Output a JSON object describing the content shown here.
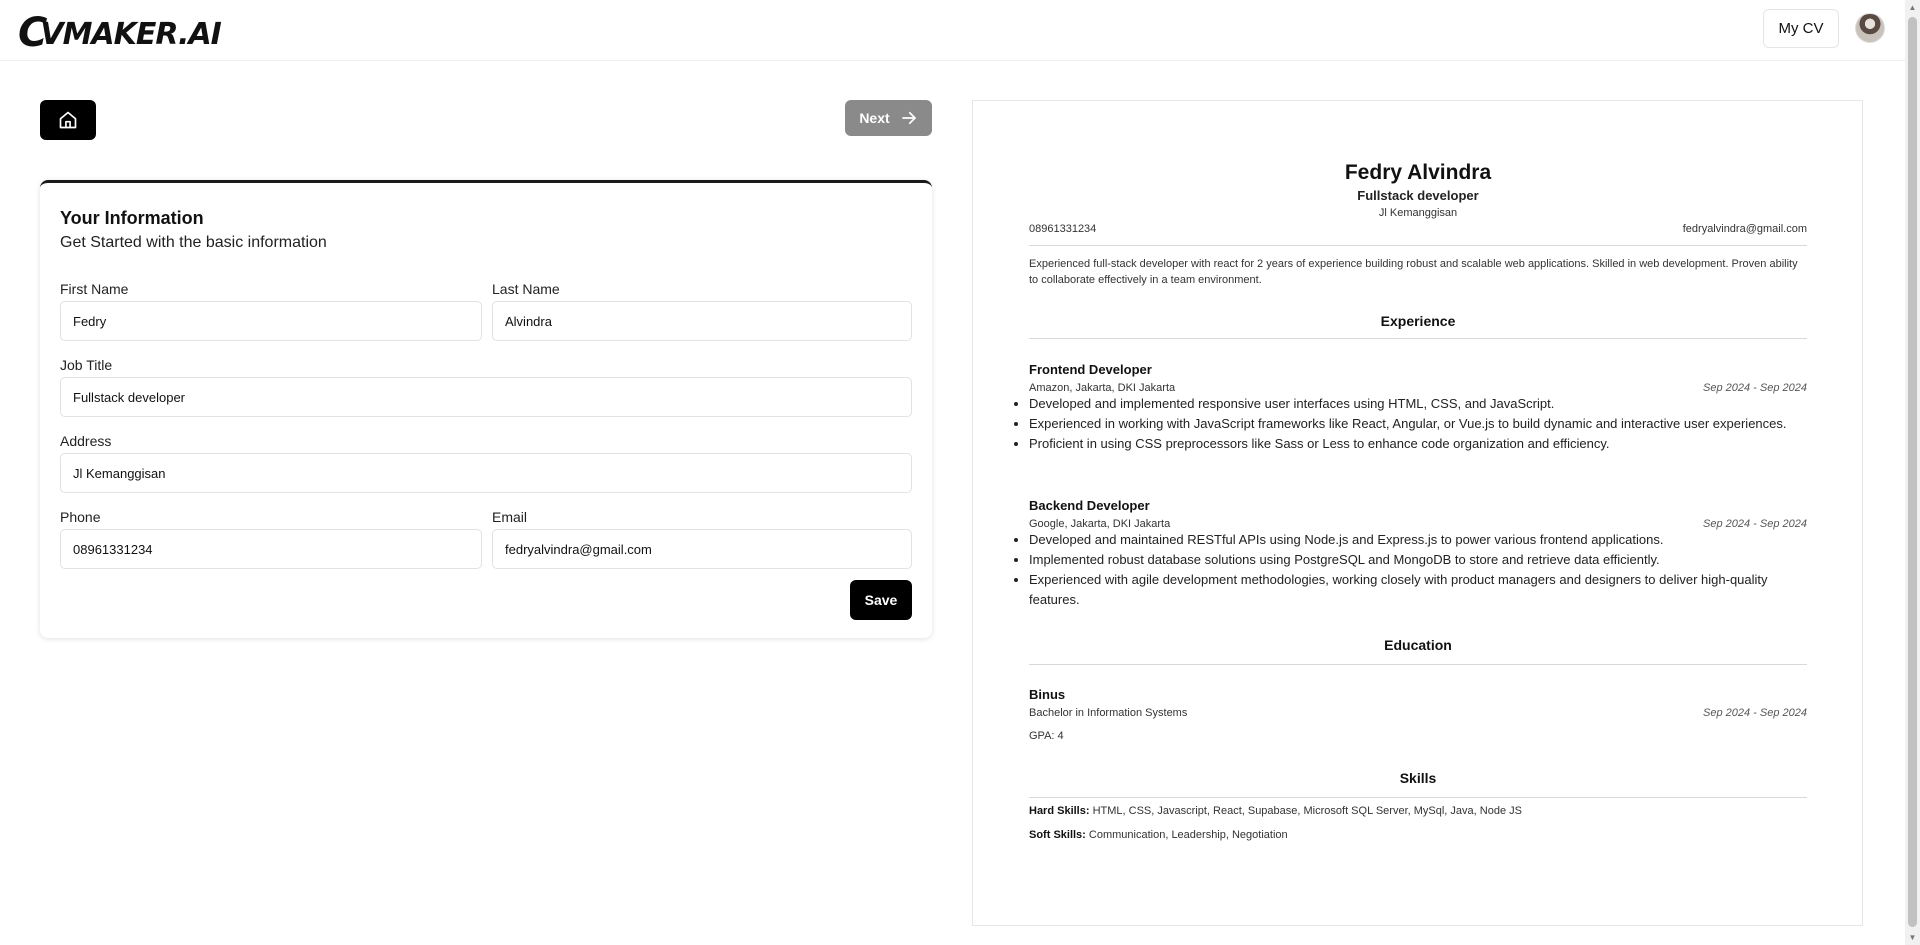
{
  "header": {
    "logo_text": "VMAKER.AI",
    "logo_prefix": "C",
    "my_cv_label": "My CV",
    "avatar_icon": "user-avatar"
  },
  "toolbar": {
    "home_icon": "home-icon",
    "next_label": "Next",
    "next_icon": "arrow-right-icon"
  },
  "form": {
    "title": "Your Information",
    "subtitle": "Get Started with the basic information",
    "first_name_label": "First Name",
    "first_name_value": "Fedry",
    "last_name_label": "Last Name",
    "last_name_value": "Alvindra",
    "job_title_label": "Job Title",
    "job_title_value": "Fullstack developer",
    "address_label": "Address",
    "address_value": "Jl Kemanggisan",
    "phone_label": "Phone",
    "phone_value": "08961331234",
    "email_label": "Email",
    "email_value": "fedryalvindra@gmail.com",
    "save_label": "Save"
  },
  "cv": {
    "name": "Fedry Alvindra",
    "job_title": "Fullstack developer",
    "address": "Jl Kemanggisan",
    "phone": "08961331234",
    "email": "fedryalvindra@gmail.com",
    "summary": "Experienced full-stack developer with react for 2 years of experience building robust and scalable web applications. Skilled in web development. Proven ability to collaborate effectively in a team environment.",
    "experience_heading": "Experience",
    "experience": [
      {
        "title": "Frontend Developer",
        "company": "Amazon, Jakarta, DKI Jakarta",
        "dates": "Sep 2024 - Sep 2024",
        "bullets": [
          "Developed and implemented responsive user interfaces using HTML, CSS, and JavaScript.",
          "Experienced in working with JavaScript frameworks like React, Angular, or Vue.js to build dynamic and interactive user experiences.",
          "Proficient in using CSS preprocessors like Sass or Less to enhance code organization and efficiency."
        ]
      },
      {
        "title": "Backend Developer",
        "company": "Google, Jakarta, DKI Jakarta",
        "dates": "Sep 2024 - Sep 2024",
        "bullets": [
          "Developed and maintained RESTful APIs using Node.js and Express.js to power various frontend applications.",
          "Implemented robust database solutions using PostgreSQL and MongoDB to store and retrieve data efficiently.",
          "Experienced with agile development methodologies, working closely with product managers and designers to deliver high-quality features."
        ]
      }
    ],
    "education_heading": "Education",
    "education": {
      "school": "Binus",
      "degree": "Bachelor in Information Systems",
      "dates": "Sep 2024 - Sep 2024",
      "gpa": "GPA: 4"
    },
    "skills_heading": "Skills",
    "hard_skills_label": "Hard Skills:",
    "hard_skills": "HTML, CSS, Javascript, React, Supabase, Microsoft SQL Server, MySql, Java, Node JS",
    "soft_skills_label": "Soft Skills:",
    "soft_skills": "Communication, Leadership, Negotiation"
  }
}
